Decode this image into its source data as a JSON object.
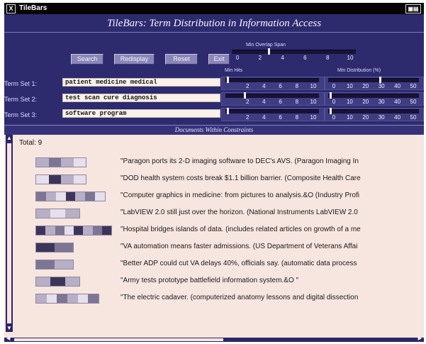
{
  "window": {
    "title": "TileBars"
  },
  "heading": "TileBars: Term Distribution in Information Access",
  "toolbar": {
    "search": "Search",
    "redisplay": "Redisplay",
    "reset": "Reset",
    "exit": "Exit"
  },
  "min_overlap": {
    "label": "Min Overlap Span",
    "ticks": [
      "0",
      "2",
      "4",
      "6",
      "8",
      "10"
    ],
    "value": 3
  },
  "min_hits_label": "Min Hits",
  "min_distribution_label": "Min Distribution (%)",
  "term_sets": [
    {
      "label": "Term Set 1:",
      "value": "patient medicine medical",
      "hits": {
        "ticks": [
          "2",
          "4",
          "6",
          "8",
          "10"
        ],
        "value": 0
      },
      "dist": {
        "ticks": [
          "0",
          "10",
          "20",
          "30",
          "40",
          "50"
        ],
        "value": 30
      }
    },
    {
      "label": "Term Set 2:",
      "value": "test scan cure diagnosis",
      "hits": {
        "ticks": [
          "2",
          "4",
          "6",
          "8",
          "10"
        ],
        "value": 2
      },
      "dist": {
        "ticks": [
          "0",
          "10",
          "20",
          "30",
          "40",
          "50"
        ],
        "value": 0
      }
    },
    {
      "label": "Term Set 3:",
      "value": "software program",
      "hits": {
        "ticks": [
          "2",
          "4",
          "6",
          "8",
          "10"
        ],
        "value": 0
      },
      "dist": {
        "ticks": [
          "0",
          "10",
          "20",
          "30",
          "40",
          "50"
        ],
        "value": 0
      }
    }
  ],
  "docs_header": "Documents Within Constraints",
  "total": "Total: 9",
  "documents": [
    {
      "title": "\"Paragon ports its 2-D imaging software to DEC's AVS. (Paragon Imaging In",
      "tiles": [
        1,
        2,
        1,
        0
      ]
    },
    {
      "title": "\"DOD health system costs break $1.1 billion barrier. (Composite Health Care",
      "tiles": [
        0,
        3,
        1,
        0
      ]
    },
    {
      "title": "\"Computer graphics in medicine: from pictures to analysis.&O  (Industry Profi",
      "tiles": [
        2,
        1,
        0,
        3,
        1,
        2,
        0
      ]
    },
    {
      "title": "\"LabVIEW 2.0 still just over the horizon. (National Instruments LabVIEW 2.0",
      "tiles": [
        1,
        0,
        1
      ]
    },
    {
      "title": "\"Hospital bridges islands of data. (includes related articles on growth of a me",
      "tiles": [
        3,
        1,
        2,
        0,
        3,
        1,
        2,
        3
      ]
    },
    {
      "title": "\"VA automation means faster admissions. (US Department of Veterans Affai",
      "tiles": [
        3,
        2
      ]
    },
    {
      "title": "\"Better ADP could cut VA delays 40%, officials say. (automatic data process",
      "tiles": [
        2,
        1
      ]
    },
    {
      "title": "\"Army tests prototype battlefield information system.&O \"",
      "tiles": [
        1,
        3,
        1
      ]
    },
    {
      "title": "\"The electric cadaver. (computerized anatomy lessons and digital dissection",
      "tiles": [
        1,
        0,
        2,
        1,
        0,
        2
      ]
    }
  ],
  "colors": {
    "window_bg": "#2e2a6e",
    "results_bg": "#f7e5df",
    "tile_shades": [
      "#e6dfec",
      "#b7afc6",
      "#7d7594",
      "#3c355a"
    ]
  }
}
